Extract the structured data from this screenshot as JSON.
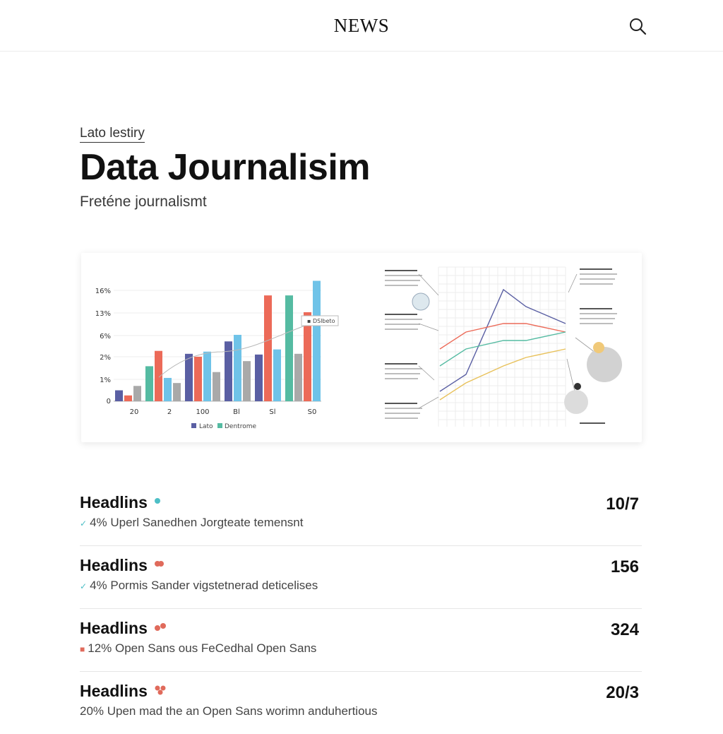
{
  "header": {
    "brand": "NEWS",
    "search_icon": "search-icon"
  },
  "article": {
    "kicker": "Lato lestiry",
    "title": "Data Journalisim",
    "subtitle": "Freténe journalismt"
  },
  "colors": {
    "navy": "#5a5fa3",
    "red": "#ec6a58",
    "teal": "#55bba2",
    "blue": "#6fc3e8",
    "gray": "#a9a9a9"
  },
  "chart_data": [
    {
      "type": "bar",
      "yticks": [
        "16%",
        "13%",
        "6%",
        "2%",
        "1%",
        "0"
      ],
      "ylim": [
        0,
        18
      ],
      "xticks": [
        "20",
        "2",
        "100",
        "Bl",
        "Sl",
        "S0"
      ],
      "legend": [
        "Lato",
        "Dentrome"
      ],
      "callout": "DSlbeto",
      "series": [
        {
          "color": "#5a5fa3",
          "values": [
            1.5,
            6.5,
            8.2,
            6.4
          ]
        },
        {
          "color": "#ec6a58",
          "values": [
            0.8,
            6.9,
            6.1,
            14.5,
            12.2
          ]
        },
        {
          "color": "#55bba2",
          "values": [
            4.8,
            14.5
          ]
        },
        {
          "color": "#6fc3e8",
          "values": [
            3.2,
            6.8,
            9.1,
            7.1,
            16.5
          ]
        },
        {
          "color": "#a9a9a9",
          "values": [
            2.1,
            2.5,
            4.0,
            5.5,
            6.5
          ]
        }
      ]
    },
    {
      "type": "line",
      "series": [
        {
          "color": "#5a5fa3",
          "values": [
            2,
            4,
            14,
            12,
            10
          ]
        },
        {
          "color": "#ec6a58",
          "values": [
            7,
            9,
            10,
            10,
            9
          ]
        },
        {
          "color": "#55bba2",
          "values": [
            5,
            7,
            8,
            8,
            9
          ]
        },
        {
          "color": "#e8c15a",
          "values": [
            1,
            3,
            5,
            6,
            7
          ]
        }
      ]
    }
  ],
  "headlines": [
    {
      "title": "Headlins",
      "meta": "4% Uperl Sanedhen Jorgteate temensnt",
      "value": "10/7",
      "dot_color": "#4dbfc6",
      "mark": "✓"
    },
    {
      "title": "Headlins",
      "meta": "4% Pormis Sander vigstetnerad deticelises",
      "value": "156",
      "dot_color": "#e06a5b",
      "mark": "✓"
    },
    {
      "title": "Headlins",
      "meta": "12% Open Sans ous FeCedhal Open Sans",
      "value": "324",
      "dot_color": "#e06a5b",
      "mark": "■"
    },
    {
      "title": "Headlins",
      "meta": "20% Upen mad the an Open Sans worimn anduhertious",
      "value": "20/3",
      "dot_color": "#e06a5b",
      "mark": ""
    }
  ]
}
